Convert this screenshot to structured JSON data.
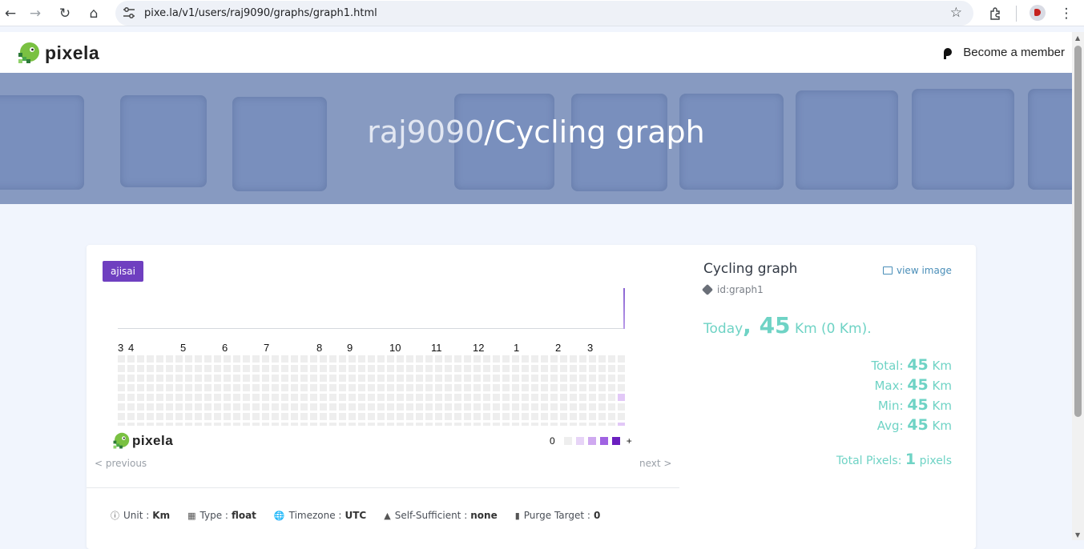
{
  "browser": {
    "url": "pixe.la/v1/users/raj9090/graphs/graph1.html",
    "back_icon": "arrow-left-icon",
    "forward_icon": "arrow-right-icon",
    "reload_icon": "reload-icon",
    "home_icon": "home-icon"
  },
  "header": {
    "logo_text": "pixela",
    "member_label": "Become a member"
  },
  "hero": {
    "user": "raj9090",
    "title": "/Cycling graph"
  },
  "graph": {
    "theme_tag": "ajisai",
    "months": [
      "3",
      "4",
      "5",
      "6",
      "7",
      "8",
      "9",
      "10",
      "11",
      "12",
      "1",
      "2",
      "3"
    ],
    "legend_low": "0",
    "legend_high": "+",
    "legend_colors": [
      "#eeeeee",
      "#e7d4f7",
      "#cfa9f0",
      "#a063e2",
      "#6a1fbf"
    ],
    "logo_text": "pixela",
    "previous_label": "< previous",
    "next_label": "next >"
  },
  "meta": {
    "unit_label": "Unit :",
    "unit_value": "Km",
    "type_label": "Type :",
    "type_value": "float",
    "timezone_label": "Timezone :",
    "timezone_value": "UTC",
    "self_label": "Self-Sufficient :",
    "self_value": "none",
    "purge_label": "Purge Target :",
    "purge_value": "0"
  },
  "info": {
    "title": "Cycling graph",
    "view_image": "view image",
    "id": "id:graph1",
    "today_label": "Today",
    "today_value": "45",
    "today_unit": "Km (0 Km).",
    "total_label": "Total:",
    "total_value": "45",
    "max_label": "Max:",
    "max_value": "45",
    "min_label": "Min:",
    "min_value": "45",
    "avg_label": "Avg:",
    "avg_value": "45",
    "unit": "Km",
    "pixels_label": "Total Pixels:",
    "pixels_value": "1",
    "pixels_unit": "pixels"
  }
}
